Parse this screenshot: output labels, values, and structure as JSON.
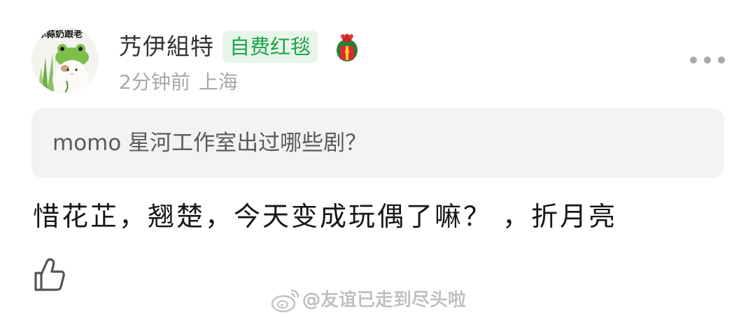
{
  "post": {
    "avatar_caption": "你蒜奶跟老",
    "author_name": "艿伊組特",
    "author_badge": "自费红毯",
    "badge_icon": "gift-red-packet-icon",
    "time": "2分钟前",
    "location": "上海",
    "more_icon": "more-dots-icon",
    "question": "momo 星河工作室出过哪些剧？",
    "answer": "惜花芷，翘楚，今天变成玩偶了嘛？ ，折月亮",
    "like_icon": "thumbs-up-icon"
  },
  "watermark": {
    "logo_icon": "weibo-logo-icon",
    "text": "@友谊已走到尽头啦"
  },
  "colors": {
    "badge_text": "#1fa24a",
    "badge_background": "#e8f5e9",
    "meta_text": "#a8a8a8",
    "card_background": "#f3f3f3"
  }
}
